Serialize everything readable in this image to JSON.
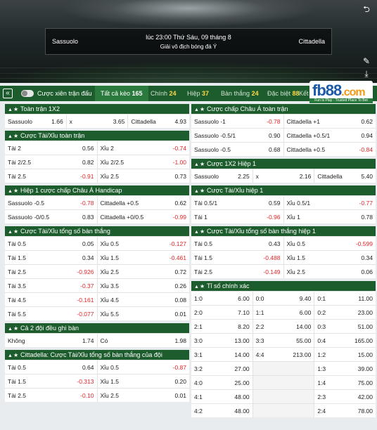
{
  "match": {
    "home": "Sassuolo",
    "away": "Cittadella",
    "time": "lúc 23:00 Thứ Sáu, 09 tháng 8",
    "league": "Giải vô địch bóng đá Ý"
  },
  "side_icons": [
    "back-icon",
    "pin-icon",
    "download-icon"
  ],
  "tabbar": {
    "toggle_label": "Cược xiên trận đấu",
    "tabs": [
      {
        "label": "Tất cả kèo",
        "count": "165"
      },
      {
        "label": "Chính",
        "count": "24"
      },
      {
        "label": "Hiệp",
        "count": "37"
      },
      {
        "label": "Bàn thắng",
        "count": "24"
      },
      {
        "label": "Đặc biệt",
        "count": "88"
      },
      {
        "label": "Kết",
        "count": ""
      }
    ]
  },
  "logo": {
    "main": "fb88",
    "suffix": ".com",
    "tagline": "Fun Is Play · Trusted Place To Bet"
  },
  "colors": {
    "header_green": "#1d5c2d",
    "tab_active": "#2a7a3d",
    "negative": "#e2262a",
    "count_yellow": "#ffd84a"
  },
  "left": [
    {
      "title": "Toàn trận 1X2",
      "rows": [
        [
          [
            "Sassuolo",
            "1.66"
          ],
          [
            "x",
            "3.65"
          ],
          [
            "Cittadella",
            "4.93"
          ]
        ]
      ]
    },
    {
      "title": "Cược Tài/Xỉu toàn trận",
      "rows": [
        [
          [
            "Tài 2",
            "0.56"
          ],
          [
            "Xỉu 2",
            "-0.74"
          ]
        ],
        [
          [
            "Tài 2/2.5",
            "0.82"
          ],
          [
            "Xỉu 2/2.5",
            "-1.00"
          ]
        ],
        [
          [
            "Tài 2.5",
            "-0.91"
          ],
          [
            "Xỉu 2.5",
            "0.73"
          ]
        ]
      ]
    },
    {
      "title": "Hiệp 1 cược chấp Châu Á Handicap",
      "rows": [
        [
          [
            "Sassuolo -0.5",
            "-0.78"
          ],
          [
            "Cittadella +0.5",
            "0.62"
          ]
        ],
        [
          [
            "Sassuolo -0/0.5",
            "0.83"
          ],
          [
            "Cittadella +0/0.5",
            "-0.99"
          ]
        ]
      ]
    },
    {
      "title": "Cược Tài/Xỉu tổng số bàn thắng",
      "rows": [
        [
          [
            "Tài 0.5",
            "0.05"
          ],
          [
            "Xỉu 0.5",
            "-0.127"
          ]
        ],
        [
          [
            "Tài 1.5",
            "0.34"
          ],
          [
            "Xỉu 1.5",
            "-0.461"
          ]
        ],
        [
          [
            "Tài 2.5",
            "-0.926"
          ],
          [
            "Xỉu 2.5",
            "0.72"
          ]
        ],
        [
          [
            "Tài 3.5",
            "-0.37"
          ],
          [
            "Xỉu 3.5",
            "0.26"
          ]
        ],
        [
          [
            "Tài 4.5",
            "-0.161"
          ],
          [
            "Xỉu 4.5",
            "0.08"
          ]
        ],
        [
          [
            "Tài 5.5",
            "-0.077"
          ],
          [
            "Xỉu 5.5",
            "0.01"
          ]
        ]
      ]
    },
    {
      "title": "Cả 2 đội đều ghi bàn",
      "rows": [
        [
          [
            "Không",
            "1.74"
          ],
          [
            "Có",
            "1.98"
          ]
        ]
      ]
    },
    {
      "title": "Cittadella: Cược Tài/Xỉu tổng số bàn thắng của đội",
      "rows": [
        [
          [
            "Tài 0.5",
            "0.64"
          ],
          [
            "Xỉu 0.5",
            "-0.87"
          ]
        ],
        [
          [
            "Tài 1.5",
            "-0.313"
          ],
          [
            "Xỉu 1.5",
            "0.20"
          ]
        ],
        [
          [
            "Tài 2.5",
            "-0.10"
          ],
          [
            "Xỉu 2.5",
            "0.01"
          ]
        ]
      ]
    }
  ],
  "right": [
    {
      "title": "Cược chấp Châu Á toàn trận",
      "rows": [
        [
          [
            "Sassuolo -1",
            "-0.78"
          ],
          [
            "Cittadella +1",
            "0.62"
          ]
        ],
        [
          [
            "Sassuolo -0.5/1",
            "0.90"
          ],
          [
            "Cittadella +0.5/1",
            "0.94"
          ]
        ],
        [
          [
            "Sassuolo -0.5",
            "0.68"
          ],
          [
            "Cittadella +0.5",
            "-0.84"
          ]
        ]
      ]
    },
    {
      "title": "Cược 1X2 Hiệp 1",
      "rows": [
        [
          [
            "Sassuolo",
            "2.25"
          ],
          [
            "x",
            "2.16"
          ],
          [
            "Cittadella",
            "5.40"
          ]
        ]
      ]
    },
    {
      "title": "Cược Tài/Xỉu hiệp 1",
      "rows": [
        [
          [
            "Tài 0.5/1",
            "0.59"
          ],
          [
            "Xỉu 0.5/1",
            "-0.77"
          ]
        ],
        [
          [
            "Tài 1",
            "-0.96"
          ],
          [
            "Xỉu 1",
            "0.78"
          ]
        ]
      ]
    },
    {
      "title": "Cược Tài/Xỉu tổng số bàn thắng hiệp 1",
      "rows": [
        [
          [
            "Tài 0.5",
            "0.43"
          ],
          [
            "Xỉu 0.5",
            "-0.599"
          ]
        ],
        [
          [
            "Tài 1.5",
            "-0.488"
          ],
          [
            "Xỉu 1.5",
            "0.34"
          ]
        ],
        [
          [
            "Tài 2.5",
            "-0.149"
          ],
          [
            "Xỉu 2.5",
            "0.06"
          ]
        ]
      ]
    },
    {
      "title": "Tỉ số chính xác",
      "rows": [
        [
          [
            "1:0",
            "6.00"
          ],
          [
            "0:0",
            "9.40"
          ],
          [
            "0:1",
            "11.00"
          ]
        ],
        [
          [
            "2:0",
            "7.10"
          ],
          [
            "1:1",
            "6.00"
          ],
          [
            "0:2",
            "23.00"
          ]
        ],
        [
          [
            "2:1",
            "8.20"
          ],
          [
            "2:2",
            "14.00"
          ],
          [
            "0:3",
            "51.00"
          ]
        ],
        [
          [
            "3:0",
            "13.00"
          ],
          [
            "3:3",
            "55.00"
          ],
          [
            "0:4",
            "165.00"
          ]
        ],
        [
          [
            "3:1",
            "14.00"
          ],
          [
            "4:4",
            "213.00"
          ],
          [
            "1:2",
            "15.00"
          ]
        ],
        [
          [
            "3:2",
            "27.00"
          ],
          null,
          [
            "1:3",
            "39.00"
          ]
        ],
        [
          [
            "4:0",
            "25.00"
          ],
          null,
          [
            "1:4",
            "75.00"
          ]
        ],
        [
          [
            "4:1",
            "48.00"
          ],
          null,
          [
            "2:3",
            "42.00"
          ]
        ],
        [
          [
            "4:2",
            "48.00"
          ],
          null,
          [
            "2:4",
            "78.00"
          ]
        ]
      ]
    }
  ]
}
